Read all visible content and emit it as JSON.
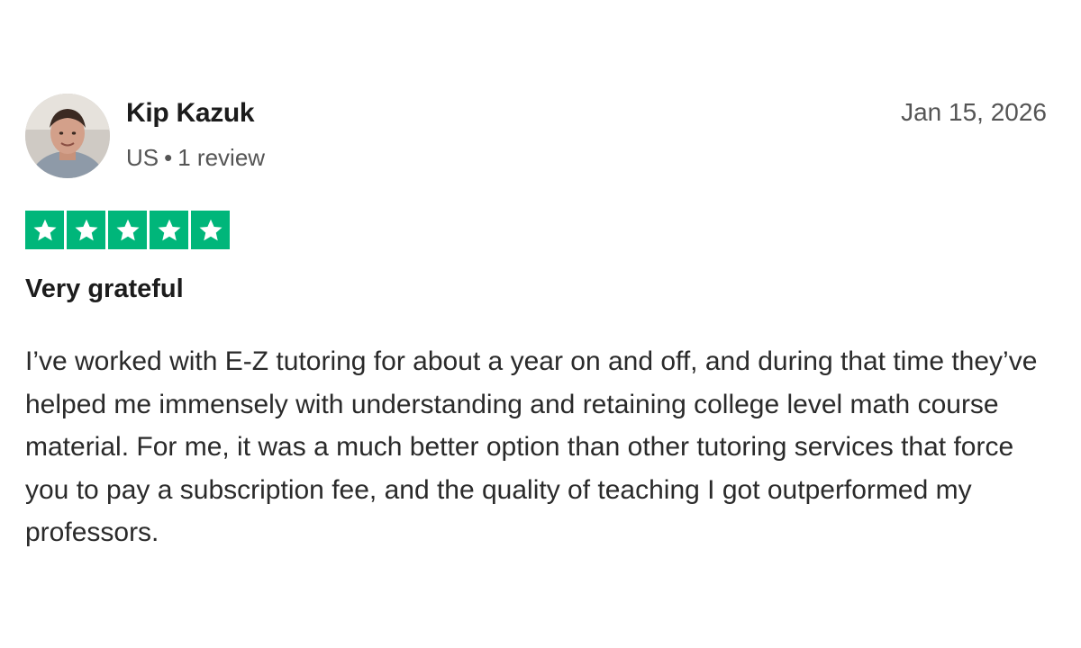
{
  "reviewer": {
    "name": "Kip Kazuk",
    "country": "US",
    "separator": "•",
    "review_count": "1 review"
  },
  "review": {
    "date": "Jan 15, 2026",
    "rating": 5,
    "rating_max": 5,
    "star_color": "#00b67a",
    "title": "Very grateful",
    "body": "I’ve worked with E-Z tutoring for about a year on and off, and during that time they’ve helped me immensely with understanding and retaining college level math course material. For me, it was a much better option than other tutoring services that force you to pay a subscription fee, and the quality of teaching I got outperformed my professors."
  }
}
